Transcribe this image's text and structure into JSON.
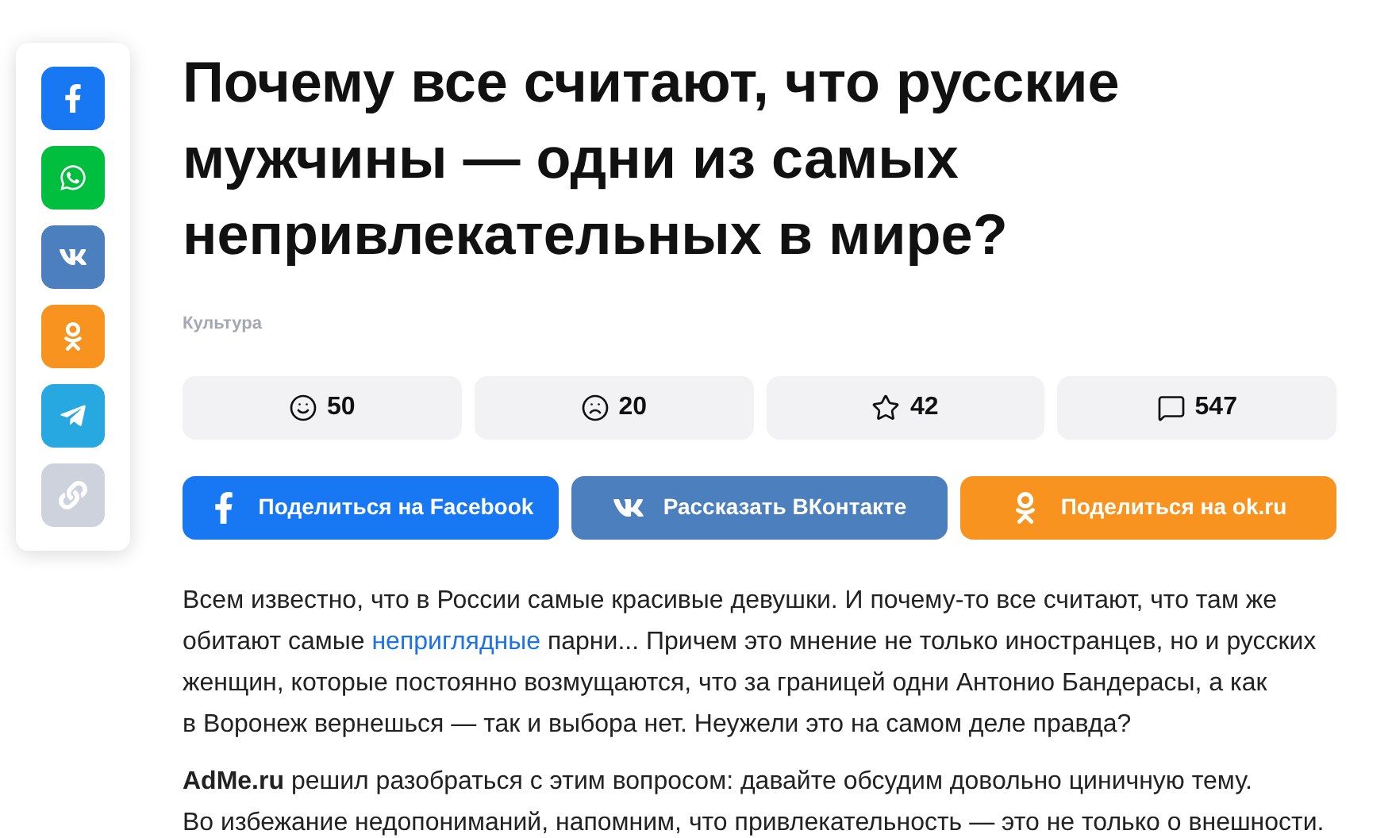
{
  "share_sidebar": [
    {
      "kind": "facebook",
      "color": "#1877f2"
    },
    {
      "kind": "whatsapp",
      "color": "#00bf3f"
    },
    {
      "kind": "vk",
      "color": "#4c7fbe"
    },
    {
      "kind": "ok",
      "color": "#f7931e"
    },
    {
      "kind": "telegram",
      "color": "#28a8e0"
    },
    {
      "kind": "link",
      "color": "#ced2dc"
    }
  ],
  "title": "Почему все считают, что русские мужчины — одни из самых непривлекательных в мире?",
  "category": "Культура",
  "reactions": [
    {
      "kind": "smile",
      "count": "50"
    },
    {
      "kind": "sad",
      "count": "20"
    },
    {
      "kind": "star",
      "count": "42"
    },
    {
      "kind": "comment",
      "count": "547"
    }
  ],
  "share_buttons": [
    {
      "kind": "facebook",
      "color": "#1877f2",
      "label": "Поделиться на Facebook"
    },
    {
      "kind": "vk",
      "color": "#4c7fbe",
      "label": "Рассказать ВКонтакте"
    },
    {
      "kind": "ok",
      "color": "#f7931e",
      "label": "Поделиться на ok.ru"
    }
  ],
  "paragraphs": [
    {
      "parts": [
        {
          "text": "Всем известно, что в России самые красивые девушки. И почему-то все считают, что там же обитают самые ",
          "link": false
        },
        {
          "text": "неприглядные",
          "link": true
        },
        {
          "text": " парни... Причем это мнение не только иностранцев, но и русских женщин, которые постоянно возмущаются, что за границей одни Антонио Бандерасы, а как в Воронеж вернешься — так и выбора нет. Неужели это на самом деле правда?",
          "link": false
        }
      ]
    },
    {
      "lines": [
        "**AdMe.ru** решил разобраться с этим вопросом: давайте обсудим довольно циничную тему.",
        "Во избежание недопониманий, напомним, что привлекательность — это не только о внешности."
      ]
    }
  ]
}
